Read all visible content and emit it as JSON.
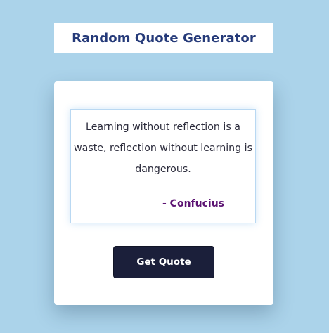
{
  "header": {
    "title": "Random Quote Generator"
  },
  "quote": {
    "text": "Learning without reflection is a waste, reflection without learning is dangerous.",
    "author": "- Confucius"
  },
  "actions": {
    "get_quote_label": "Get Quote"
  },
  "colors": {
    "background": "#abd3ea",
    "title_text": "#253a79",
    "author_text": "#5c1373",
    "button_bg": "#1b1f3a"
  }
}
